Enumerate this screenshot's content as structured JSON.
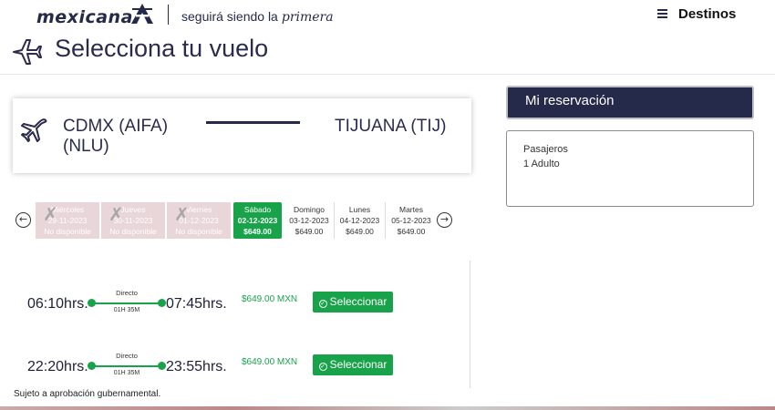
{
  "header": {
    "brand": "mexicana",
    "tagline": "seguirá siendo la",
    "tagline_script": "primera",
    "menu_label": "Destinos"
  },
  "page": {
    "title": "Selecciona tu vuelo"
  },
  "route": {
    "origin": "CDMX (AIFA) (NLU)",
    "destination": "TIJUANA (TIJ)"
  },
  "dates": [
    {
      "day": "Miércoles",
      "date": "29-11-2023",
      "status": "No disponible",
      "state": "disabled"
    },
    {
      "day": "Jueves",
      "date": "30-11-2023",
      "status": "No disponible",
      "state": "disabled"
    },
    {
      "day": "Viernes",
      "date": "01-12-2023",
      "status": "No disponible",
      "state": "disabled"
    },
    {
      "day": "Sábado",
      "date": "02-12-2023",
      "status": "$649.00",
      "state": "active"
    },
    {
      "day": "Domingo",
      "date": "03-12-2023",
      "status": "$649.00",
      "state": "normal"
    },
    {
      "day": "Lunes",
      "date": "04-12-2023",
      "status": "$649.00",
      "state": "normal"
    },
    {
      "day": "Martes",
      "date": "05-12-2023",
      "status": "$649.00",
      "state": "normal"
    }
  ],
  "flights": [
    {
      "departure": "06:10hrs.",
      "arrival": "07:45hrs.",
      "type": "Directo",
      "duration": "01H 35M",
      "fare": "$649.00 MXN",
      "button": "Seleccionar"
    },
    {
      "departure": "22:20hrs.",
      "arrival": "23:55hrs.",
      "type": "Directo",
      "duration": "01H 35M",
      "fare": "$649.00 MXN",
      "button": "Seleccionar"
    }
  ],
  "disclaimer": "Sujeto a aprobación gubernamental.",
  "reservation": {
    "title": "Mi reservación",
    "passengers_label": "Pasajeros",
    "passengers_value": "1 Adulto"
  },
  "colors": {
    "brand_navy": "#262a4a",
    "accent_green": "#18a34a",
    "disabled_pink": "#e9d6d8"
  }
}
